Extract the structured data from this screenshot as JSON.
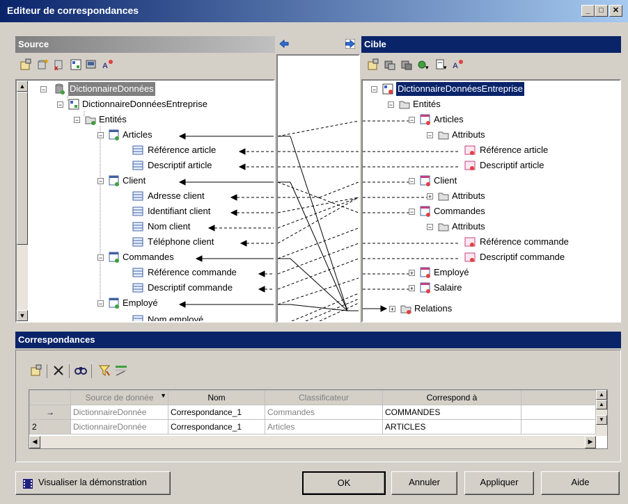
{
  "window": {
    "title": "Editeur de correspondances"
  },
  "source": {
    "header": "Source",
    "tree": [
      {
        "label": "DictionnaireDonnées"
      },
      {
        "label": "DictionnaireDonnéesEntreprise"
      },
      {
        "label": "Entités"
      },
      {
        "label": "Articles"
      },
      {
        "label": "Référence article"
      },
      {
        "label": "Descriptif article"
      },
      {
        "label": "Client"
      },
      {
        "label": "Adresse client"
      },
      {
        "label": "Identifiant client"
      },
      {
        "label": "Nom client"
      },
      {
        "label": "Téléphone client"
      },
      {
        "label": "Commandes"
      },
      {
        "label": "Référence commande"
      },
      {
        "label": "Descriptif commande"
      },
      {
        "label": "Employé"
      },
      {
        "label": "Nom employé"
      }
    ]
  },
  "target": {
    "header": "Cible",
    "tree": [
      {
        "label": "DictionnaireDonnéesEntreprise"
      },
      {
        "label": "Entités"
      },
      {
        "label": "Articles"
      },
      {
        "label": "Attributs"
      },
      {
        "label": "Référence article"
      },
      {
        "label": "Descriptif article"
      },
      {
        "label": "Client"
      },
      {
        "label": "Attributs"
      },
      {
        "label": "Commandes"
      },
      {
        "label": "Attributs"
      },
      {
        "label": "Référence commande"
      },
      {
        "label": "Descriptif commande"
      },
      {
        "label": "Employé"
      },
      {
        "label": "Salaire"
      },
      {
        "label": "Relations"
      }
    ]
  },
  "correspondances": {
    "header": "Correspondances",
    "columns": [
      "Source de donnée",
      "Nom",
      "Classificateur",
      "Correspond à"
    ],
    "rows": [
      {
        "marker": "→",
        "source": "DictionnaireDonnée",
        "name": "Correspondance_1",
        "classifier": "Commandes",
        "target": "COMMANDES"
      },
      {
        "marker": "2",
        "source": "DictionnaireDonnée",
        "name": "Correspondance_1",
        "classifier": "Articles",
        "target": "ARTICLES"
      }
    ]
  },
  "buttons": {
    "demo": "Visualiser la démonstration",
    "ok": "OK",
    "cancel": "Annuler",
    "apply": "Appliquer",
    "help": "Aide"
  },
  "colors": {
    "title_start": "#0a246a",
    "title_end": "#a6caf0",
    "selection": "#0a246a"
  }
}
